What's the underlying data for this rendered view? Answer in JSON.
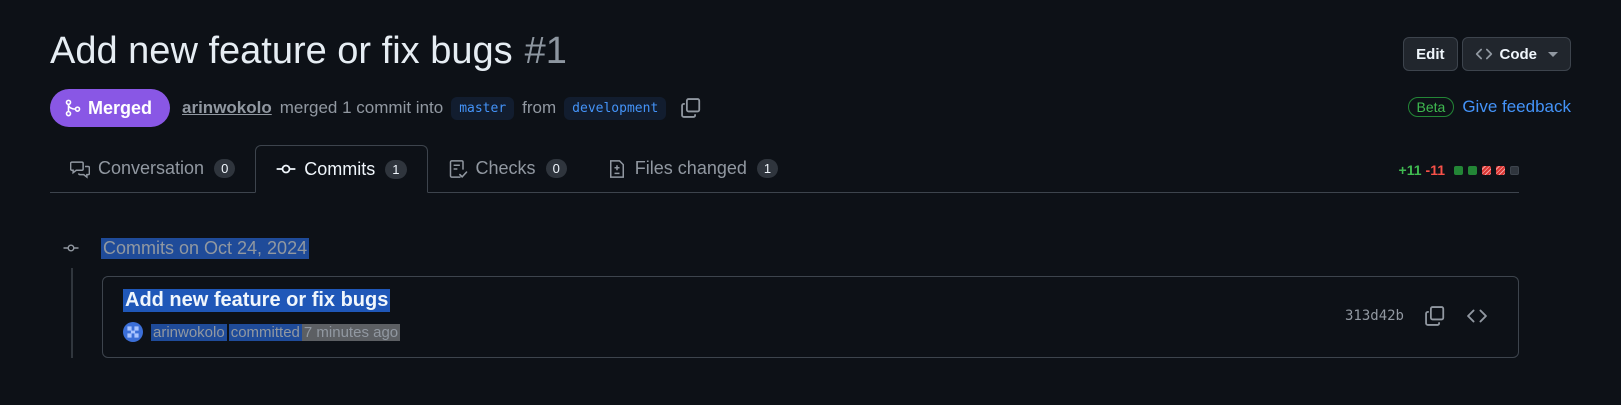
{
  "header": {
    "title": "Add new feature or fix bugs",
    "number": "#1",
    "edit_label": "Edit",
    "code_label": "Code"
  },
  "meta": {
    "status": "Merged",
    "author": "arinwokolo",
    "action_text": "merged 1 commit into",
    "base_branch": "master",
    "from_text": "from",
    "head_branch": "development"
  },
  "feedback": {
    "beta_label": "Beta",
    "link_label": "Give feedback"
  },
  "tabs": [
    {
      "label": "Conversation",
      "count": "0"
    },
    {
      "label": "Commits",
      "count": "1"
    },
    {
      "label": "Checks",
      "count": "0"
    },
    {
      "label": "Files changed",
      "count": "1"
    }
  ],
  "diffstat": {
    "additions": "+11",
    "deletions": "-11"
  },
  "commits": {
    "date_heading": "Commits on Oct 24, 2024",
    "items": [
      {
        "title": "Add new feature or fix bugs",
        "author": "arinwokolo",
        "verb": "committed",
        "time": "7 minutes ago",
        "sha": "313d42b"
      }
    ]
  },
  "colors": {
    "background": "#0d1117",
    "merged": "#8957e5",
    "link": "#4493f8",
    "addition": "#3fb950",
    "deletion": "#f85149"
  }
}
